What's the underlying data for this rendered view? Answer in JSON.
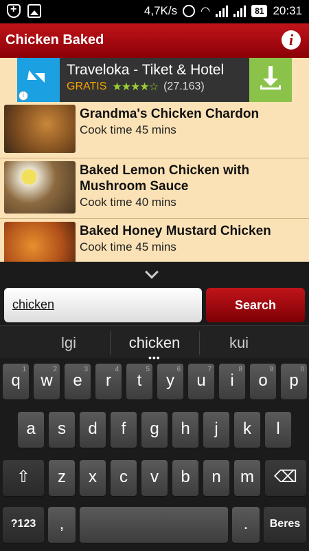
{
  "status": {
    "speed": "4,7K/s",
    "battery": "81",
    "time": "20:31",
    "icons": [
      "shield-plus-icon",
      "image-icon",
      "alarm-icon",
      "wifi-icon",
      "signal-icon"
    ]
  },
  "appbar": {
    "title": "Chicken Baked",
    "info_icon": "i"
  },
  "ad": {
    "title": "Traveloka - Tiket & Hotel",
    "price": "GRATIS",
    "stars": "★★★★☆",
    "reviews": "(27.163)",
    "info": "i"
  },
  "recipes": [
    {
      "title": "Grandma's Chicken Chardon",
      "cook": "Cook time 45 mins"
    },
    {
      "title": "Baked Lemon Chicken with Mushroom Sauce",
      "cook": "Cook time 40 mins"
    },
    {
      "title": "Baked Honey Mustard Chicken",
      "cook": "Cook time 45 mins"
    }
  ],
  "search": {
    "value": "chicken",
    "button": "Search"
  },
  "suggestions": [
    "lgi",
    "chicken",
    "kui"
  ],
  "keyboard": {
    "row1": [
      {
        "k": "q",
        "n": "1"
      },
      {
        "k": "w",
        "n": "2"
      },
      {
        "k": "e",
        "n": "3"
      },
      {
        "k": "r",
        "n": "4"
      },
      {
        "k": "t",
        "n": "5"
      },
      {
        "k": "y",
        "n": "6"
      },
      {
        "k": "u",
        "n": "7"
      },
      {
        "k": "i",
        "n": "8"
      },
      {
        "k": "o",
        "n": "9"
      },
      {
        "k": "p",
        "n": "0"
      }
    ],
    "row2": [
      "a",
      "s",
      "d",
      "f",
      "g",
      "h",
      "j",
      "k",
      "l"
    ],
    "row3": [
      "z",
      "x",
      "c",
      "v",
      "b",
      "n",
      "m"
    ],
    "symbols": "?123",
    "comma": ",",
    "period": ".",
    "enter": "Beres"
  }
}
